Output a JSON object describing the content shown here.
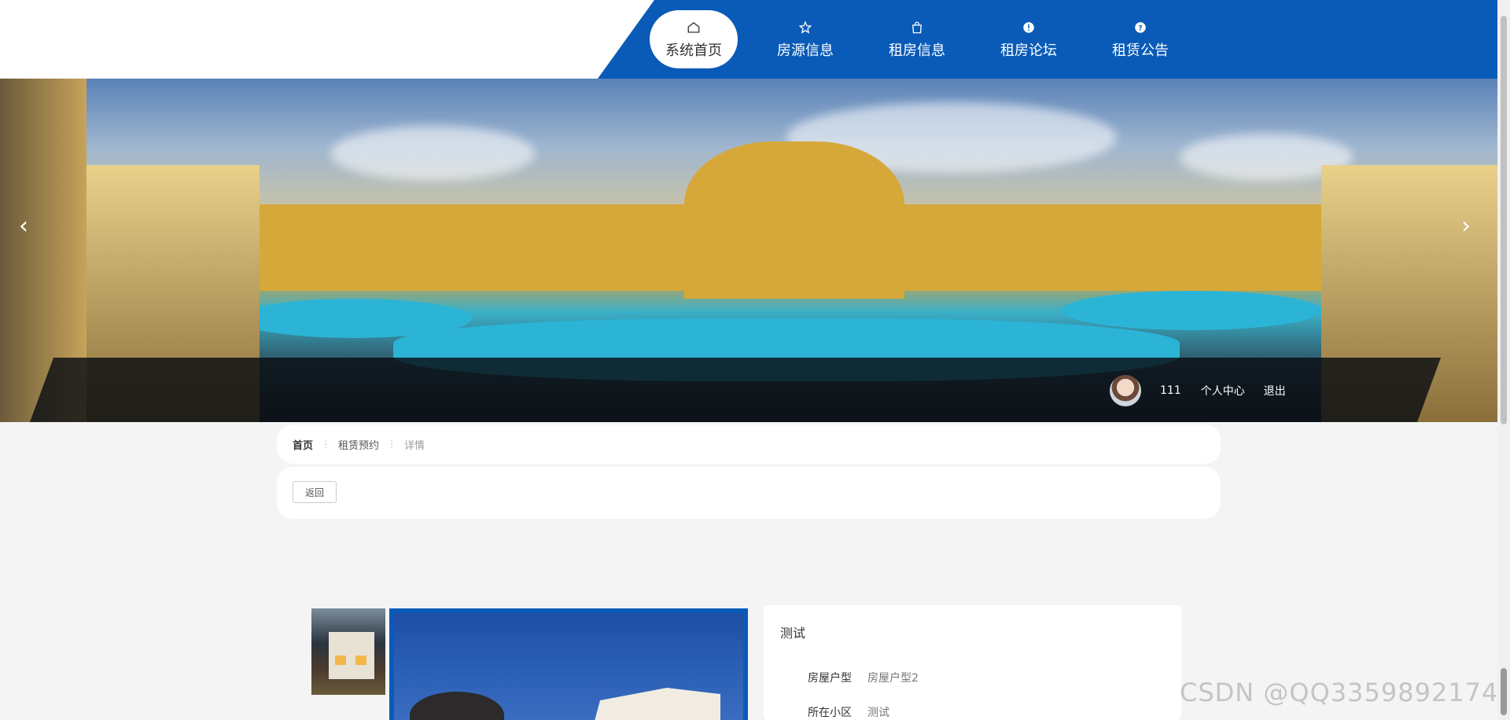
{
  "nav": {
    "items": [
      {
        "label": "系统首页",
        "icon": "home-icon",
        "active": true
      },
      {
        "label": "房源信息",
        "icon": "star-icon",
        "active": false
      },
      {
        "label": "租房信息",
        "icon": "bag-icon",
        "active": false
      },
      {
        "label": "租房论坛",
        "icon": "alert-icon",
        "active": false
      },
      {
        "label": "租赁公告",
        "icon": "question-icon",
        "active": false
      }
    ],
    "accent": "#0a5bb8"
  },
  "banner": {
    "prev_arrow": "‹",
    "next_arrow": "›"
  },
  "user": {
    "name": "111",
    "profile_label": "个人中心",
    "logout_label": "退出"
  },
  "breadcrumb": {
    "items": [
      "首页",
      "租赁预约",
      "详情"
    ],
    "separator": "⋮"
  },
  "actions": {
    "back_label": "返回"
  },
  "detail": {
    "title": "测试",
    "fields": [
      {
        "label": "房屋户型",
        "value": "房屋户型2"
      },
      {
        "label": "所在小区",
        "value": "测试"
      }
    ]
  },
  "watermark": "CSDN @QQ3359892174"
}
